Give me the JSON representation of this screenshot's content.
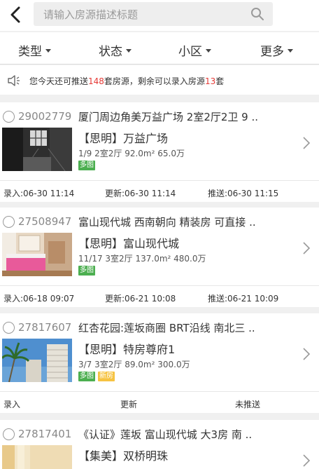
{
  "search": {
    "placeholder": "请输入房源描述标题"
  },
  "filters": [
    "类型",
    "状态",
    "小区",
    "更多"
  ],
  "notice": {
    "pre": "您今天还可推送",
    "push_count": "148",
    "mid": "套房源，剩余可以录入房源",
    "entry_count": "13",
    "post": "套"
  },
  "listings": [
    {
      "id": "29002779",
      "title": "厦门周边角美万益广场 2室2厅2卫 9 ..",
      "district": "【思明】万益广场",
      "specs": "1/9  2室2厅  92.0m²  65.0万",
      "tags": [
        "多图"
      ],
      "entered": "录入:06-30 11:14",
      "updated": "更新:06-30 11:14",
      "pushed": "推送:06-30 11:15"
    },
    {
      "id": "27508947",
      "title": "富山现代城 西南朝向 精装房 可直接 ..",
      "district": "【思明】富山现代城",
      "specs": "11/17  3室2厅  137.0m²  480.0万",
      "tags": [
        "多图"
      ],
      "entered": "录入:06-18 09:07",
      "updated": "更新:06-21 10:08",
      "pushed": "推送:06-21 10:09"
    },
    {
      "id": "27817607",
      "title": "红杏花园:莲坂商圈 BRT沿线 南北三 ..",
      "district": "【思明】特房尊府1",
      "specs": "3/7  3室2厅  89.0m²  300.0万",
      "tags": [
        "多图",
        "新房"
      ],
      "entered": "录入",
      "updated": "更新",
      "pushed": "未推送"
    },
    {
      "id": "27817401",
      "title": "《认证》莲坂 富山现代城 大3房 南 ..",
      "district": "【集美】双桥明珠",
      "specs": "",
      "tags": [],
      "entered": "",
      "updated": "",
      "pushed": ""
    }
  ],
  "colors": {
    "accent_red": "#e53935",
    "tag_green": "#4caf50",
    "tag_yellow": "#f6c342"
  }
}
